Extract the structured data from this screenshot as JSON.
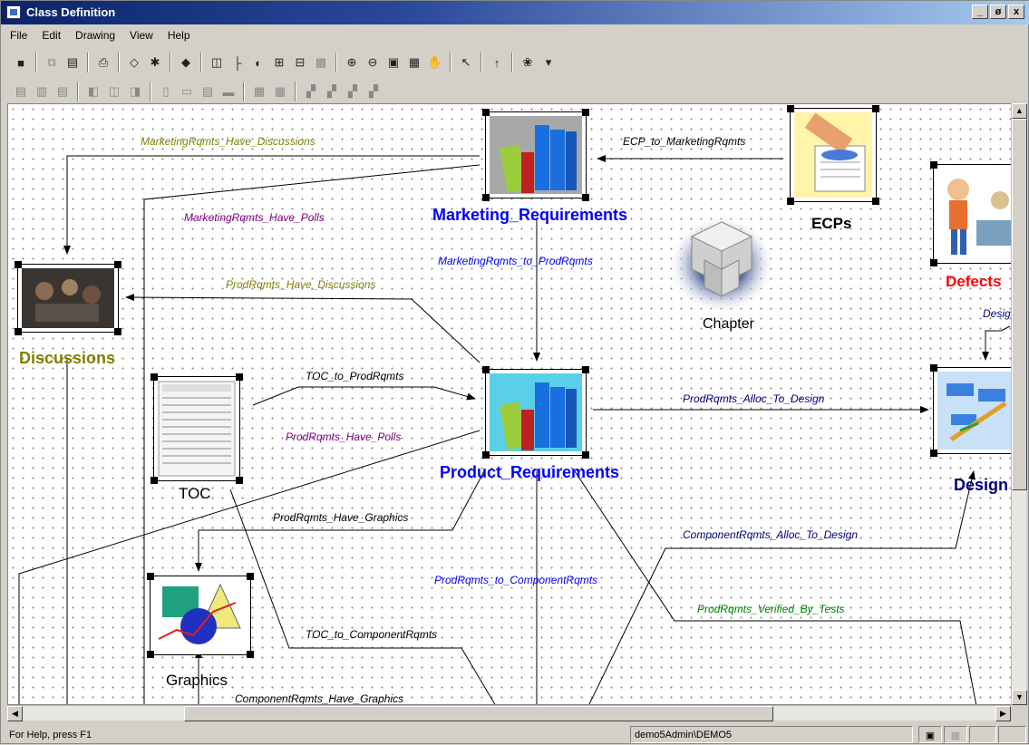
{
  "window": {
    "title": "Class Definition",
    "controls": [
      "_",
      "ø",
      "x"
    ]
  },
  "menu": [
    "File",
    "Edit",
    "Drawing",
    "View",
    "Help"
  ],
  "nodes": {
    "marketing": "Marketing_Requirements",
    "ecps": "ECPs",
    "defects": "Defects",
    "chapter": "Chapter",
    "discussions": "Discussions",
    "toc": "TOC",
    "product": "Product_Requirements",
    "design": "Design",
    "graphics": "Graphics"
  },
  "relations": {
    "mr_discussions": "MarketingRqmts_Have_Discussions",
    "ecp_mr": "ECP_to_MarketingRqmts",
    "mr_polls": "MarketingRqmts_Have_Polls",
    "mr_pr": "MarketingRqmts_to_ProdRqmts",
    "pr_discussions": "ProdRqmts_Have_Discussions",
    "desig": "Desig",
    "toc_pr": "TOC_to_ProdRqmts",
    "pr_design": "ProdRqmts_Alloc_To_Design",
    "pr_polls": "ProdRqmts_Have_Polls",
    "pr_graphics": "ProdRqmts_Have_Graphics",
    "cr_design": "ComponentRqmts_Alloc_To_Design",
    "pr_cr": "ProdRqmts_to_ComponentRqmts",
    "pr_tests": "ProdRqmts_Verified_By_Tests",
    "toc_cr": "TOC_to_ComponentRqmts",
    "cr_graphics": "ComponentRqmts_Have_Graphics"
  },
  "colors": {
    "olive": "#808000",
    "purple": "#800080",
    "blue": "#0000ff",
    "navy": "#000080",
    "green": "#008000",
    "red": "#ff0000"
  },
  "status": {
    "help": "For Help, press F1",
    "user": "demo5Admin\\DEMO5"
  }
}
